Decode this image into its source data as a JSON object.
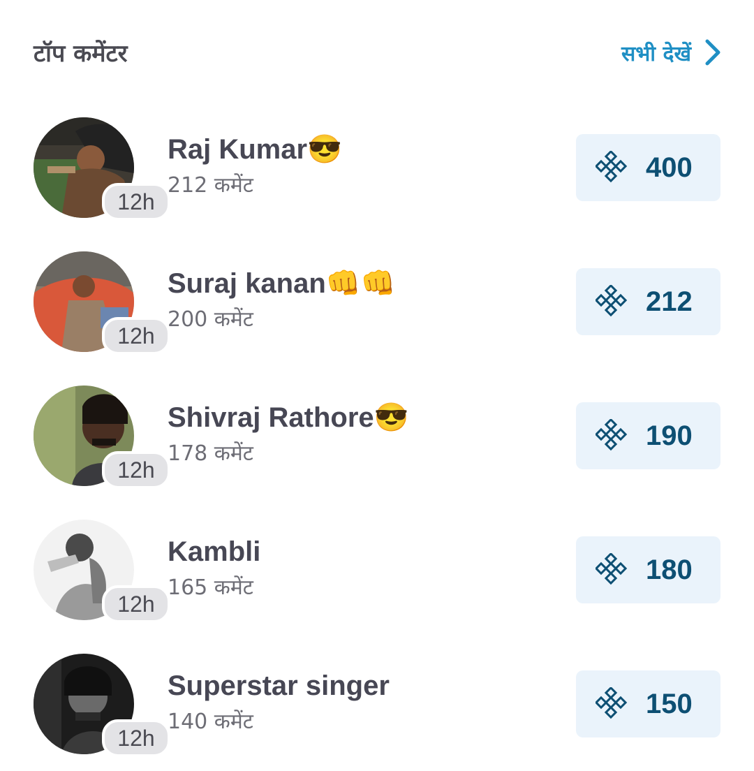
{
  "header": {
    "title": "टॉप कमेंटर",
    "see_all_label": "सभी देखें",
    "see_all_icon": "chevron-right-icon",
    "accent_color": "#1f8fc4"
  },
  "commenters": [
    {
      "name": "Raj Kumar😎",
      "comments": "212 कमेंट",
      "time": "12h",
      "score": "400"
    },
    {
      "name": "Suraj kanan👊👊",
      "comments": "200 कमेंट",
      "time": "12h",
      "score": "212"
    },
    {
      "name": "Shivraj Rathore😎",
      "comments": "178 कमेंट",
      "time": "12h",
      "score": "190"
    },
    {
      "name": "Kambli",
      "comments": "165 कमेंट",
      "time": "12h",
      "score": "180"
    },
    {
      "name": "Superstar singer",
      "comments": "140 कमेंट",
      "time": "12h",
      "score": "150"
    }
  ],
  "score_icon": "knot-icon",
  "score_color": "#0d4f73",
  "score_bg_color": "#eaf3fb"
}
